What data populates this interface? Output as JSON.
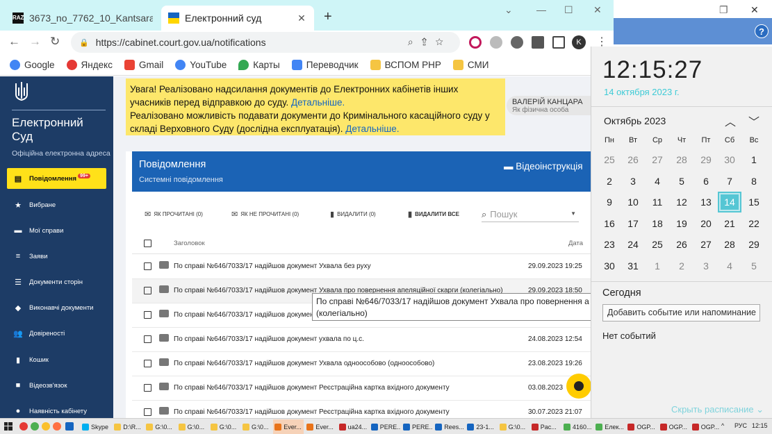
{
  "browser": {
    "tabs": [
      {
        "label": "3673_no_7762_10_Kantsara_v",
        "active": false
      },
      {
        "label": "Електронний суд",
        "active": true
      }
    ],
    "new_tab": "+",
    "url": "https://cabinet.court.gov.ua/notifications",
    "profile_initial": "K",
    "bookmarks": [
      "Google",
      "Яндекс",
      "Gmail",
      "YouTube",
      "Карты",
      "Переводчик",
      "ВСПОМ РНР",
      "СМИ"
    ]
  },
  "sidebar": {
    "brand": "Електронний Суд",
    "brand_sub": "Офіційна електронна адреса",
    "items": [
      {
        "label": "Повідомлення",
        "badge": "99+",
        "active": true
      },
      {
        "label": "Вибране"
      },
      {
        "label": "Мої справи"
      },
      {
        "label": "Заяви"
      },
      {
        "label": "Документи сторін"
      },
      {
        "label": "Виконавчі документи"
      },
      {
        "label": "Довіреності"
      },
      {
        "label": "Кошик"
      },
      {
        "label": "Відеозв'язок"
      },
      {
        "label": "Наявність кабінету"
      }
    ]
  },
  "notice": {
    "line1": "Увага! Реалізовано надсилання документів до Електронних кабінетів інших учасників перед відправкою до суду.",
    "link1": "Детальніше.",
    "line2": "Реалізовано можливість подавати документи до Кримінального касаційного суду у складі Верховного Суду (дослідна експлуатація).",
    "link2": "Детальніше."
  },
  "user": {
    "name": "ВАЛЕРІЙ КАНЦАРА",
    "role": "Як фізична особа"
  },
  "panel": {
    "title": "Повідомлення",
    "subtitle": "Системні повідомлення",
    "video": "Відеоінструкція",
    "actions": {
      "mark_read": "ЯК ПРОЧИТАНІ (0)",
      "mark_unread": "ЯК НЕ ПРОЧИТАНІ (0)",
      "delete": "ВИДАЛИТИ (0)",
      "delete_all": "ВИДАЛИТИ ВСЕ"
    },
    "search_placeholder": "Пошук",
    "col_title": "Заголовок",
    "col_date": "Дата",
    "rows": [
      {
        "text": "По справі №646/7033/17 надійшов документ Ухвала без руху",
        "date": "29.09.2023 19:25"
      },
      {
        "text": "По справі №646/7033/17 надійшов документ Ухвала про повернення апеляційної скарги (колегіально)",
        "date": "29.09.2023 18:50"
      },
      {
        "text": "По справі №646/7033/17 надійшов документ",
        "date": ""
      },
      {
        "text": "По справі №646/7033/17 надійшов документ ухвала по ц.с.",
        "date": "24.08.2023 12:54"
      },
      {
        "text": "По справі №646/7033/17 надійшов документ Ухвала одноособово (одноособово)",
        "date": "23.08.2023 19:26"
      },
      {
        "text": "По справі №646/7033/17 надійшов документ Реєстраційна картка вхідного документу",
        "date": "03.08.2023"
      },
      {
        "text": "По справі №646/7033/17 надійшов документ Реєстраційна картка вхідного документу",
        "date": "30.07.2023 21:07"
      }
    ],
    "tooltip_l1": "По справі №646/7033/17 надійшов документ Ухвала про повернення а",
    "tooltip_l2": "(колегіально)"
  },
  "calendar": {
    "time": "12:15:27",
    "date_long": "14 октября 2023 г.",
    "month": "Октябрь 2023",
    "dow": [
      "Пн",
      "Вт",
      "Ср",
      "Чт",
      "Пт",
      "Сб",
      "Вс"
    ],
    "days": [
      [
        "25",
        "26",
        "27",
        "28",
        "29",
        "30",
        "1"
      ],
      [
        "2",
        "3",
        "4",
        "5",
        "6",
        "7",
        "8"
      ],
      [
        "9",
        "10",
        "11",
        "12",
        "13",
        "14",
        "15"
      ],
      [
        "16",
        "17",
        "18",
        "19",
        "20",
        "21",
        "22"
      ],
      [
        "23",
        "24",
        "25",
        "26",
        "27",
        "28",
        "29"
      ],
      [
        "30",
        "31",
        "1",
        "2",
        "3",
        "4",
        "5"
      ]
    ],
    "today": "14",
    "today_label": "Сегодня",
    "add_event": "Добавить событие или напоминание",
    "no_events": "Нет событий",
    "hide_schedule": "Скрыть расписание"
  },
  "taskbar": {
    "items": [
      "Skype",
      "D:\\R...",
      "G:\\0...",
      "G:\\0...",
      "G:\\0...",
      "G:\\0...",
      "Ever...",
      "Ever...",
      "ua24...",
      "PERE...",
      "PERE...",
      "Rees...",
      "23-1...",
      "G:\\0...",
      "Pac...",
      "4160...",
      "Елек...",
      "OGP...",
      "OGP...",
      "OGP..."
    ],
    "lang": "РУС",
    "time": "12:15"
  },
  "colors": {
    "brand_blue": "#1b63b5",
    "sidebar": "#1d3c66",
    "accent_yellow": "#ffe119",
    "today_cyan": "#55c6d4"
  }
}
